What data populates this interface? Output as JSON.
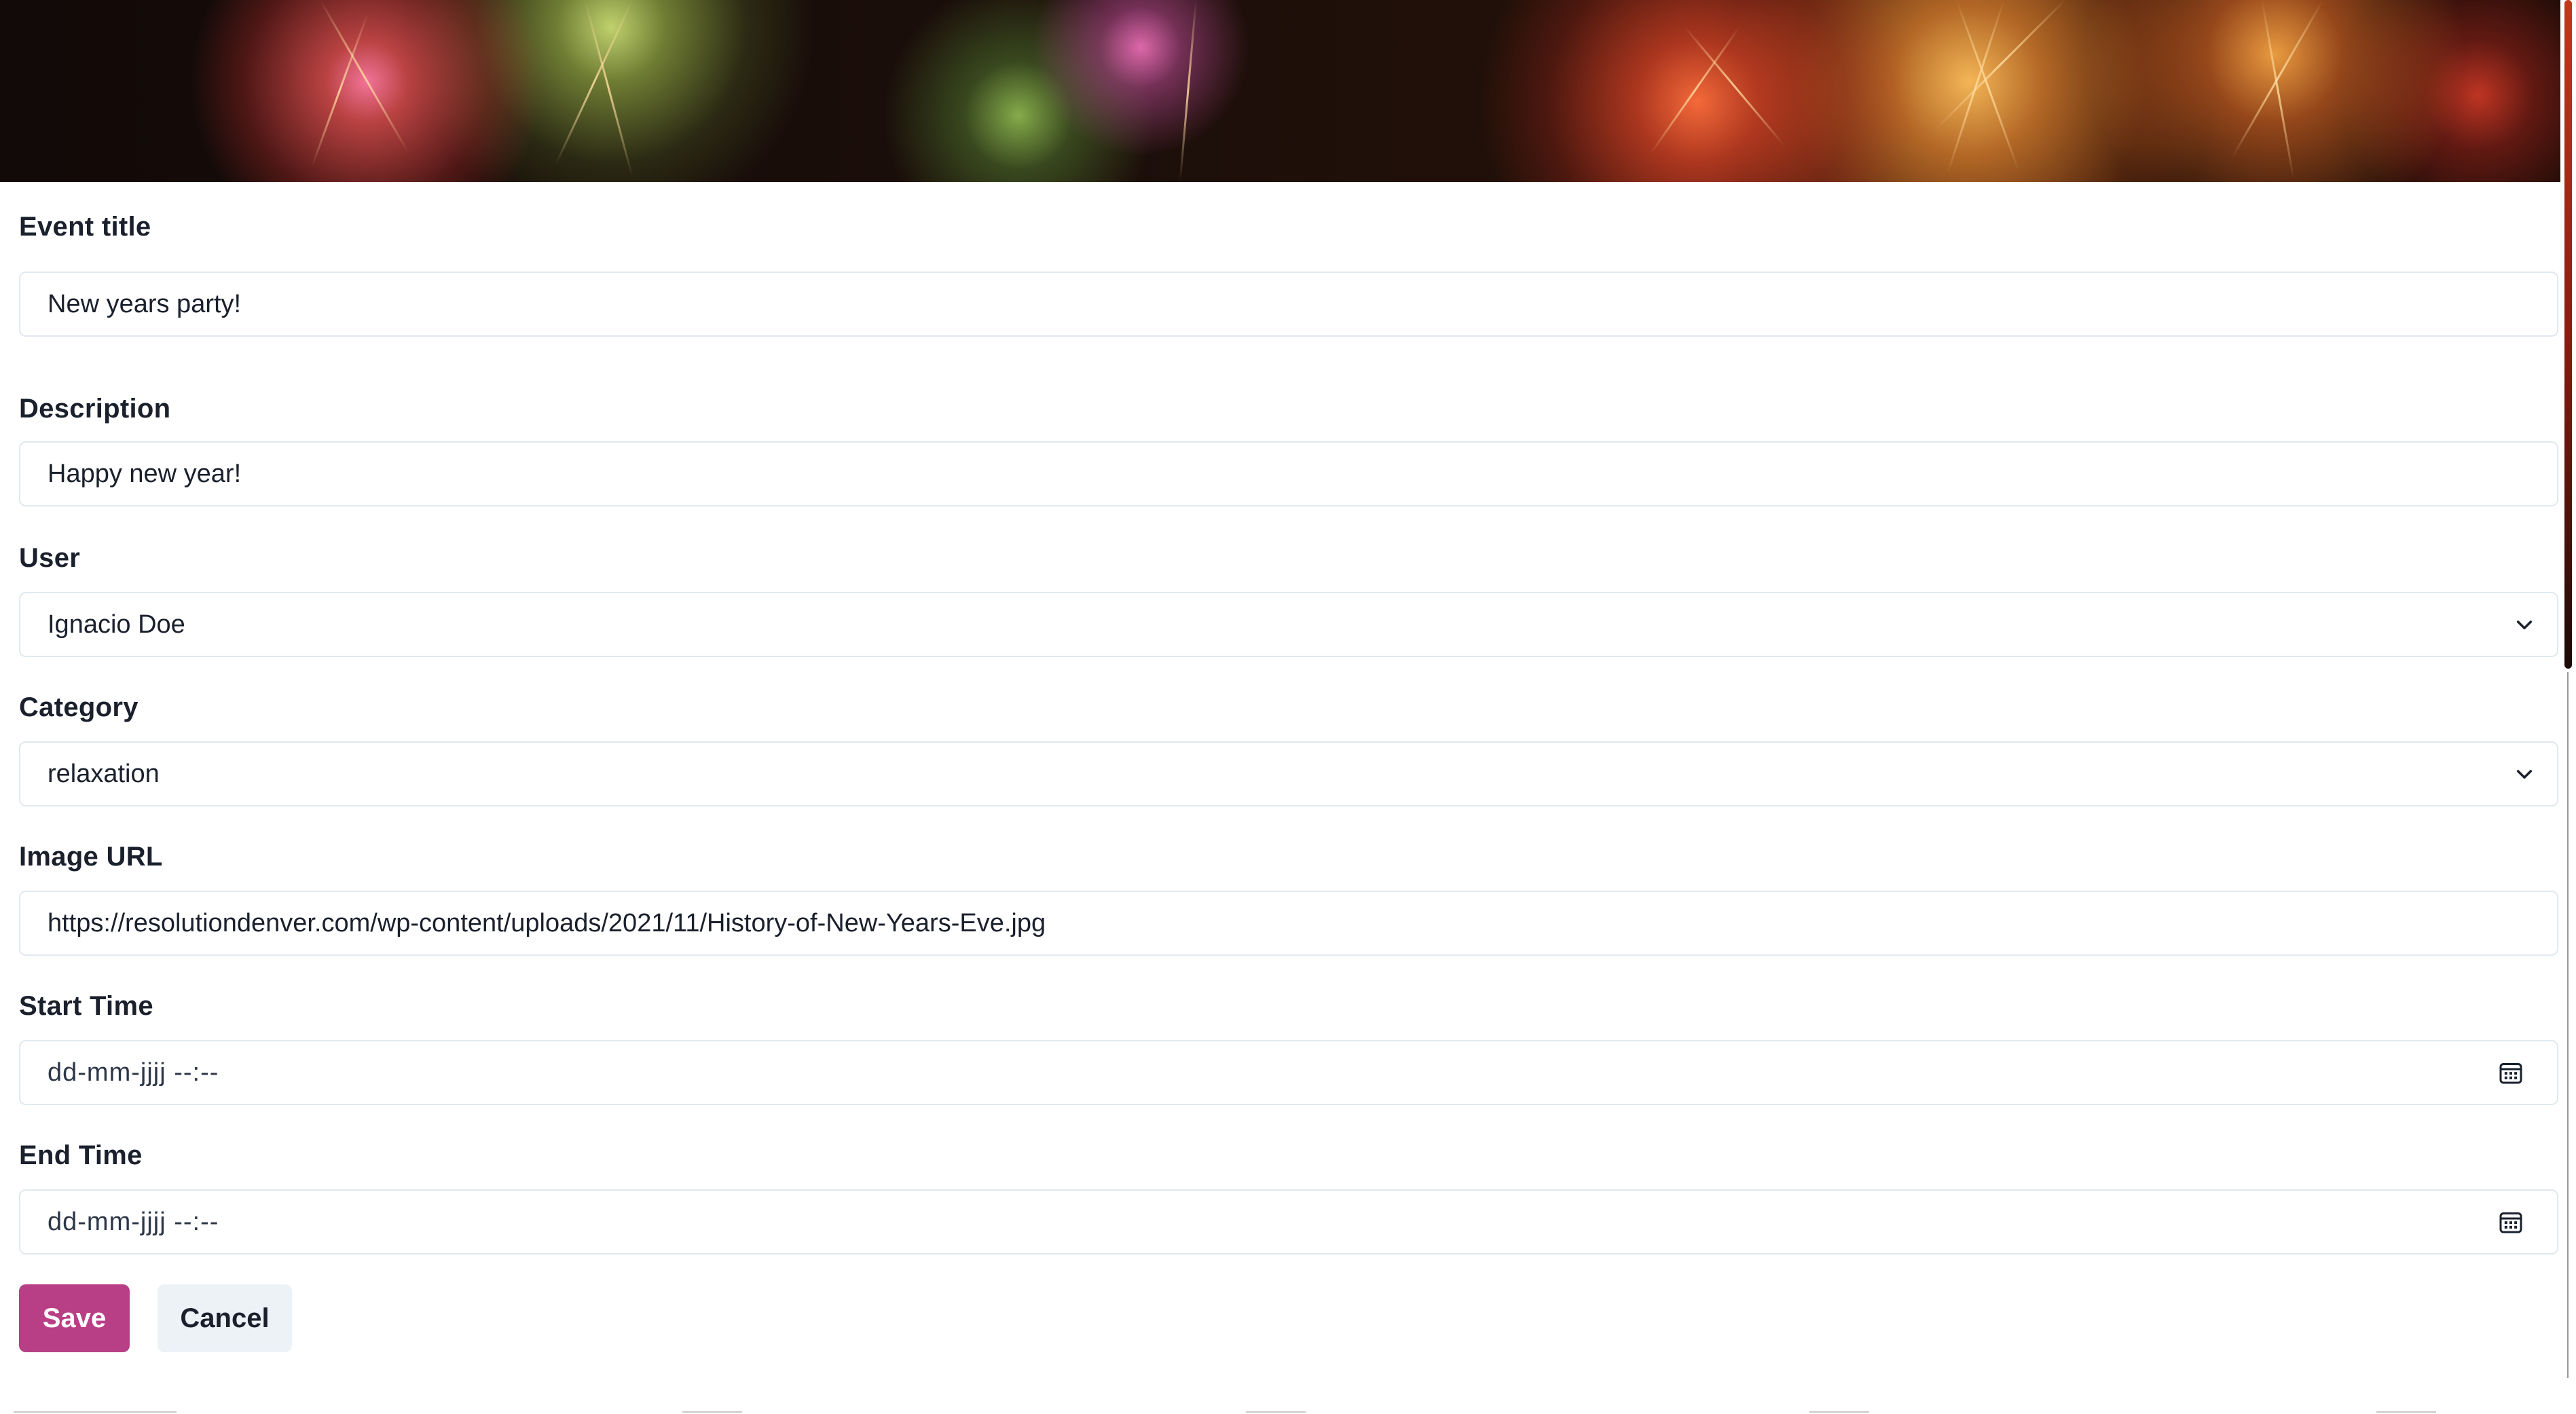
{
  "hero": {
    "image_name": "fireworks-banner"
  },
  "form": {
    "event_title": {
      "label": "Event title",
      "value": "New years party!"
    },
    "description": {
      "label": "Description",
      "value": "Happy new year!"
    },
    "user": {
      "label": "User",
      "selected": "Ignacio Doe",
      "icon": "chevron-down-icon"
    },
    "category": {
      "label": "Category",
      "selected": "relaxation",
      "icon": "chevron-down-icon"
    },
    "image_url": {
      "label": "Image URL",
      "value": "https://resolutiondenver.com/wp-content/uploads/2021/11/History-of-New-Years-Eve.jpg"
    },
    "start_time": {
      "label": "Start Time",
      "placeholder": "dd-mm-jjjj --:--",
      "icon": "calendar-icon"
    },
    "end_time": {
      "label": "End Time",
      "placeholder": "dd-mm-jjjj --:--",
      "icon": "calendar-icon"
    },
    "buttons": {
      "save_label": "Save",
      "cancel_label": "Cancel"
    }
  },
  "colors": {
    "save_button_bg": "#b83f86",
    "cancel_button_bg": "#edf2f7",
    "field_border": "#e2e8f0",
    "text": "#1a202c"
  }
}
